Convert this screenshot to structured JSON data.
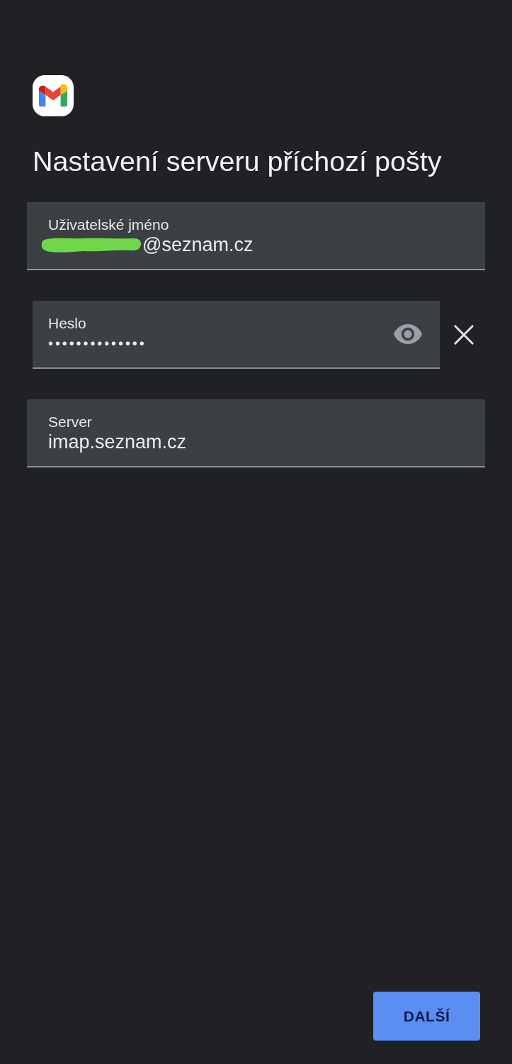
{
  "title": "Nastavení serveru příchozí pošty",
  "fields": [
    {
      "kind": "text",
      "label": "Uživatelské jméno",
      "value": "@seznam.cz",
      "redacted": true
    },
    {
      "kind": "password",
      "label": "Heslo",
      "value": "••••••••••••••"
    },
    {
      "kind": "text",
      "label": "Server",
      "value": "imap.seznam.cz"
    }
  ],
  "next_button": {
    "label": "DALŠÍ"
  }
}
